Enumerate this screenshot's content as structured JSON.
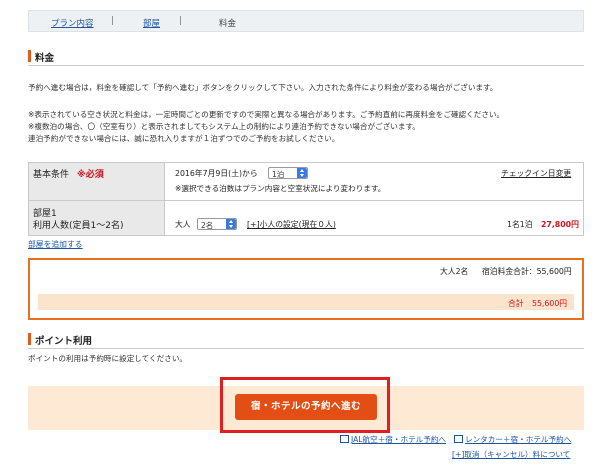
{
  "tabs": [
    {
      "label": "プラン内容"
    },
    {
      "label": "部屋"
    },
    {
      "label": "料金"
    }
  ],
  "price_section": {
    "title": "料金",
    "intro": "予約へ進む場合は，料金を確認して「予約へ進む」ボタンをクリックして下さい。入力された条件により料金が変わる場合がございます。",
    "notes": [
      "※表示されている空き状況と料金は，一定時間ごとの更新ですので実際と異なる場合があります。ご予約直前に再度料金をご確認ください。",
      "※複数泊の場合、〇（空室有り）と表示されましてもシステム上の制約により連泊予約できない場合がございます。",
      "連泊予約ができない場合には、誠に恐れ入りますが１泊ずつでのご予約をお試しください。"
    ]
  },
  "conditions": {
    "basic_label": "基本条件",
    "required": "※必須",
    "date": "2016年7月9日(土)から",
    "nights": "1泊",
    "checkin_link": "チェックイン日変更",
    "nights_note": "※選択できる泊数はプラン内容と空室状況により変わります。",
    "room_label": "部屋1",
    "people_label": "利用人数(定員1〜2名)",
    "adult_label": "大人",
    "adult_count": "2名",
    "child_link": "[+]小人の設定(現在０人)",
    "per_person_label": "1名1泊",
    "per_person_price": "27,800円"
  },
  "add_room_link": "部屋を追加する",
  "summary": {
    "adults": "大人2名",
    "total_label": "宿泊料金合計：55,600円",
    "grand_label": "合計",
    "grand_value": "55,600円"
  },
  "points_section": {
    "title": "ポイント利用",
    "note": "ポイントの利用は予約時に設定してください。"
  },
  "cta": {
    "label": "宿・ホテルの予約へ進む"
  },
  "footer_links": {
    "jal": "JAL航空＋宿・ホテル予約へ",
    "rental": "レンタカー＋宿・ホテル予約へ",
    "cancel": "[+]取消（キャンセル）料について"
  },
  "colors": {
    "accent": "#e24e14",
    "price": "#d0121b",
    "link": "#1a55a8",
    "highlight_frame": "#e02020"
  }
}
